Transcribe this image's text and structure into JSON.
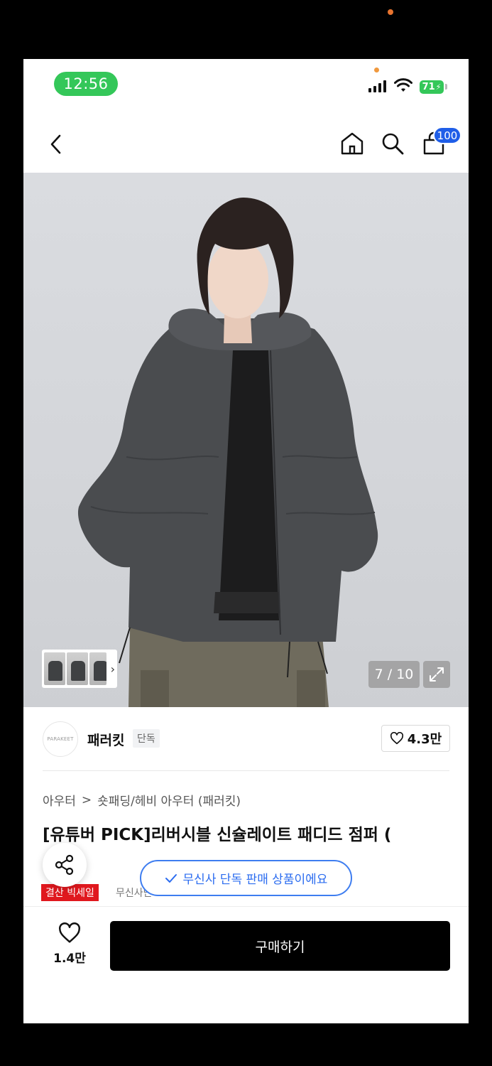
{
  "status_bar": {
    "time": "12:56",
    "battery": "71"
  },
  "nav": {
    "back_icon": "chevron-left-icon",
    "home_icon": "home-icon",
    "search_icon": "search-icon",
    "cart_icon": "shopping-bag-icon",
    "cart_badge": "100",
    "accent_color": "#1f5ee8"
  },
  "gallery": {
    "page_counter": "7 / 10",
    "expand_icon": "expand-icon",
    "thumbnail_chevron": "›"
  },
  "brand": {
    "logo_text": "PARAKEET",
    "name": "패러킷",
    "badge": "단독",
    "likes": "4.3만"
  },
  "product": {
    "breadcrumb": [
      "아우터",
      "숏패딩/헤비 아우터 (패러킷)"
    ],
    "breadcrumb_separator": ">",
    "title": "[유튜버 PICK]리버시블 신슐레이트 패디드 점퍼 (",
    "sale_badge": "결산 빅세일",
    "sale_color": "#e0181e",
    "musinsa_tag": "무신사단",
    "exclusive_toast": "무신사 단독 판매 상품이에요",
    "toast_color": "#2b6cf0"
  },
  "bottom_bar": {
    "wish_count": "1.4만",
    "buy_label": "구매하기"
  }
}
